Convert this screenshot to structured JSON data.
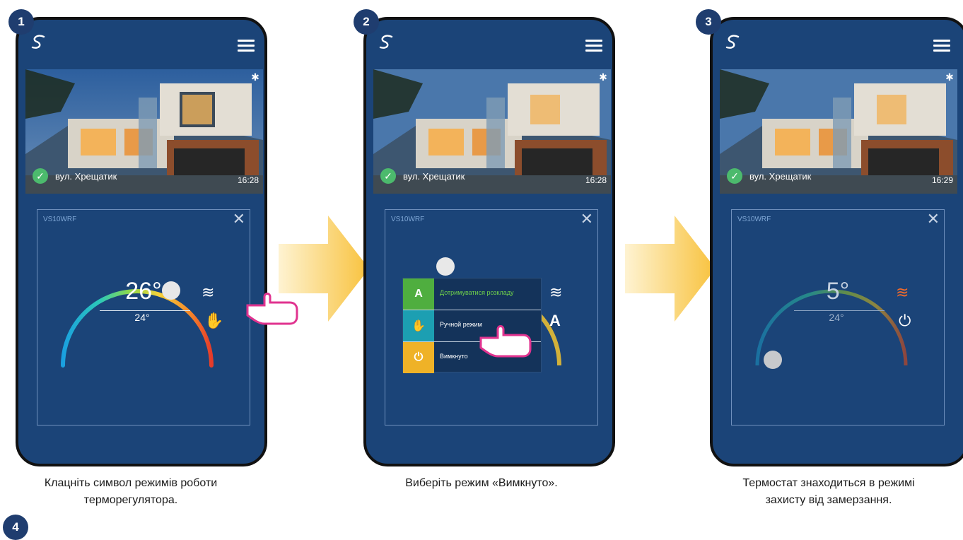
{
  "steps": [
    {
      "number": "1",
      "location": "вул. Хрещатик",
      "time": "16:28",
      "device": "VS10WRF",
      "temp_big": "26°",
      "temp_small": "24°",
      "caption_line1": "Клацніть символ режимів роботи",
      "caption_line2": "терморегулятора."
    },
    {
      "number": "2",
      "location": "вул. Хрещатик",
      "time": "16:28",
      "device": "VS10WRF",
      "menu": [
        "Дотримуватися розкладу",
        "Ручной режим",
        "Вимкнуто"
      ],
      "caption_line1": "Виберіть режим «Вимкнуто».",
      "caption_line2": ""
    },
    {
      "number": "3",
      "location": "вул. Хрещатик",
      "time": "16:29",
      "device": "VS10WRF",
      "temp_big": "5°",
      "temp_small": "24°",
      "caption_line1": "Термостат знаходиться в режимі",
      "caption_line2": "захисту від замерзання."
    }
  ],
  "footer_badge": "4",
  "colors": {
    "phone_bg": "#1b4478",
    "badge": "#1f3d6f",
    "arrow": "#f9c548",
    "pointer": "#e0338f"
  },
  "icons": [
    "logo-icon",
    "menu-icon",
    "gear-icon",
    "check-icon",
    "close-icon",
    "heat-icon",
    "hand-mode-icon",
    "power-icon",
    "schedule-icon"
  ]
}
